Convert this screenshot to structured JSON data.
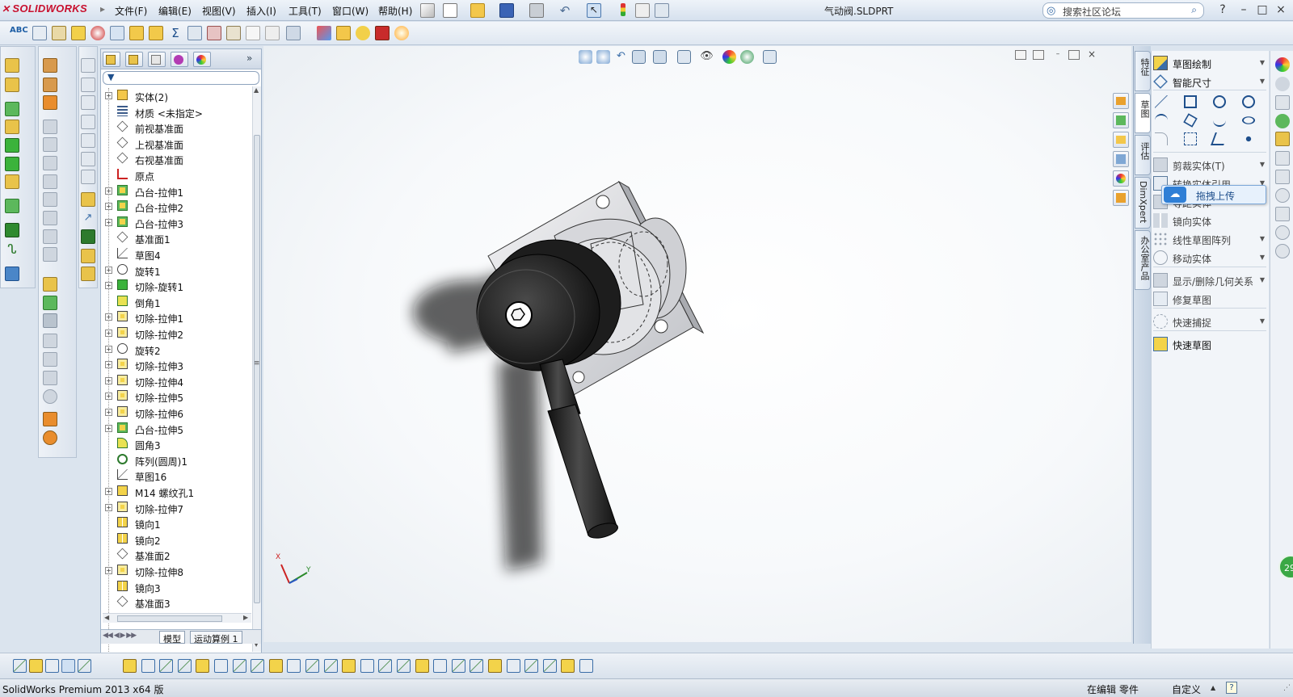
{
  "app": {
    "brand": "SOLIDWORKS",
    "document_title": "气动阀.SLDPRT"
  },
  "menu": [
    "文件(F)",
    "编辑(E)",
    "视图(V)",
    "插入(I)",
    "工具(T)",
    "窗口(W)",
    "帮助(H)"
  ],
  "search": {
    "placeholder": "搜索社区论坛"
  },
  "window_buttons": {
    "help": "?",
    "minimize": "–",
    "restore": "□",
    "close": "×"
  },
  "feature_tree": {
    "items": [
      {
        "label": "实体(2)",
        "expandable": true,
        "icon": "solid-bodies-folder-icon"
      },
      {
        "label": "材质 <未指定>",
        "expandable": false,
        "icon": "material-icon"
      },
      {
        "label": "前视基准面",
        "expandable": false,
        "icon": "plane-icon"
      },
      {
        "label": "上视基准面",
        "expandable": false,
        "icon": "plane-icon"
      },
      {
        "label": "右视基准面",
        "expandable": false,
        "icon": "plane-icon"
      },
      {
        "label": "原点",
        "expandable": false,
        "icon": "origin-icon"
      },
      {
        "label": "凸台-拉伸1",
        "expandable": true,
        "icon": "boss-extrude-icon"
      },
      {
        "label": "凸台-拉伸2",
        "expandable": true,
        "icon": "boss-extrude-icon"
      },
      {
        "label": "凸台-拉伸3",
        "expandable": true,
        "icon": "boss-extrude-icon"
      },
      {
        "label": "基准面1",
        "expandable": false,
        "icon": "plane-icon"
      },
      {
        "label": "草图4",
        "expandable": false,
        "icon": "sketch-icon"
      },
      {
        "label": "旋转1",
        "expandable": true,
        "icon": "revolve-icon"
      },
      {
        "label": "切除-旋转1",
        "expandable": true,
        "icon": "cut-revolve-icon"
      },
      {
        "label": "倒角1",
        "expandable": false,
        "icon": "chamfer-icon"
      },
      {
        "label": "切除-拉伸1",
        "expandable": true,
        "icon": "cut-extrude-icon"
      },
      {
        "label": "切除-拉伸2",
        "expandable": true,
        "icon": "cut-extrude-icon"
      },
      {
        "label": "旋转2",
        "expandable": true,
        "icon": "revolve-icon"
      },
      {
        "label": "切除-拉伸3",
        "expandable": true,
        "icon": "cut-extrude-icon"
      },
      {
        "label": "切除-拉伸4",
        "expandable": true,
        "icon": "cut-extrude-icon"
      },
      {
        "label": "切除-拉伸5",
        "expandable": true,
        "icon": "cut-extrude-icon"
      },
      {
        "label": "切除-拉伸6",
        "expandable": true,
        "icon": "cut-extrude-icon"
      },
      {
        "label": "凸台-拉伸5",
        "expandable": true,
        "icon": "boss-extrude-icon"
      },
      {
        "label": "圆角3",
        "expandable": false,
        "icon": "fillet-icon"
      },
      {
        "label": "阵列(圆周)1",
        "expandable": false,
        "icon": "circular-pattern-icon"
      },
      {
        "label": "草图16",
        "expandable": false,
        "icon": "sketch-icon"
      },
      {
        "label": "M14 螺纹孔1",
        "expandable": true,
        "icon": "hole-wizard-icon"
      },
      {
        "label": "切除-拉伸7",
        "expandable": true,
        "icon": "cut-extrude-icon"
      },
      {
        "label": "镜向1",
        "expandable": false,
        "icon": "mirror-icon"
      },
      {
        "label": "镜向2",
        "expandable": false,
        "icon": "mirror-icon"
      },
      {
        "label": "基准面2",
        "expandable": false,
        "icon": "plane-icon"
      },
      {
        "label": "切除-拉伸8",
        "expandable": true,
        "icon": "cut-extrude-icon"
      },
      {
        "label": "镜向3",
        "expandable": false,
        "icon": "mirror-icon"
      },
      {
        "label": "基准面3",
        "expandable": false,
        "icon": "plane-icon"
      }
    ],
    "bottom_tabs": [
      "模型",
      "运动算例 1"
    ]
  },
  "right_tabs": [
    "特征",
    "草图",
    "评估",
    "DimXpert",
    "办公室产品"
  ],
  "sketch_panel": {
    "items": [
      {
        "label": "草图绘制",
        "enabled": true,
        "icon": "sketch-icon",
        "dropdown": true
      },
      {
        "label": "智能尺寸",
        "enabled": true,
        "icon": "smart-dimension-icon",
        "dropdown": true
      },
      {
        "label": "剪裁实体(T)",
        "enabled": false,
        "icon": "trim-icon",
        "dropdown": true
      },
      {
        "label": "转换实体引用",
        "enabled": false,
        "icon": "convert-entities-icon",
        "dropdown": true
      },
      {
        "label": "等距实体",
        "enabled": false,
        "icon": "offset-icon",
        "dropdown": false
      },
      {
        "label": "镜向实体",
        "enabled": false,
        "icon": "mirror-entities-icon",
        "dropdown": false
      },
      {
        "label": "线性草图阵列",
        "enabled": false,
        "icon": "linear-pattern-icon",
        "dropdown": true
      },
      {
        "label": "移动实体",
        "enabled": false,
        "icon": "move-entities-icon",
        "dropdown": true
      },
      {
        "label": "显示/删除几何关系",
        "enabled": false,
        "icon": "relations-icon",
        "dropdown": true
      },
      {
        "label": "修复草图",
        "enabled": false,
        "icon": "repair-sketch-icon",
        "dropdown": false
      },
      {
        "label": "快速捕捉",
        "enabled": false,
        "icon": "quick-snaps-icon",
        "dropdown": true
      },
      {
        "label": "快速草图",
        "enabled": true,
        "icon": "rapid-sketch-icon",
        "dropdown": false
      }
    ]
  },
  "upload_popup": {
    "label": "拖拽上传"
  },
  "badge": {
    "value": "29"
  },
  "triad": {
    "x_label": "X",
    "y_label": "Y"
  },
  "status": {
    "product": "SolidWorks Premium 2013 x64 版",
    "mode": "在编辑 零件",
    "custom": "自定义",
    "help": "?"
  },
  "colors": {
    "brand": "#c8102e",
    "accent": "#3b6ea8",
    "panel_bg": "#dbe4ee",
    "model_dark": "#2a2a2a",
    "model_light": "#d9dadd"
  }
}
